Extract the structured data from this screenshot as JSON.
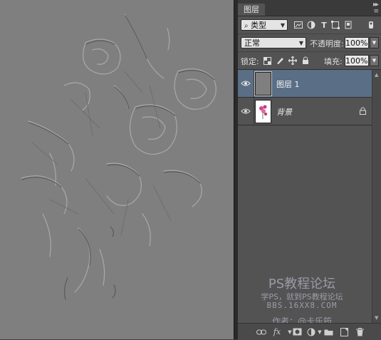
{
  "panel": {
    "tab_label": "图层",
    "filter_select": "类型",
    "blend_mode": "正常",
    "opacity_label": "不透明度:",
    "opacity_value": "100%",
    "lock_label": "锁定:",
    "fill_label": "填充:",
    "fill_value": "100%"
  },
  "layers": [
    {
      "name": "图层 1",
      "selected": true,
      "visible": true
    },
    {
      "name": "背景",
      "selected": false,
      "visible": true,
      "locked": true
    }
  ],
  "watermark": {
    "line1": "PS教程论坛",
    "line2": "学PS，就到PS教程论坛",
    "line3": "BBS.16XX8.COM",
    "line4": "作者：@卡乐筠"
  },
  "colors": {
    "canvas": "#7f7f7f",
    "panel": "#535353",
    "selected_layer": "#5a6e86"
  }
}
